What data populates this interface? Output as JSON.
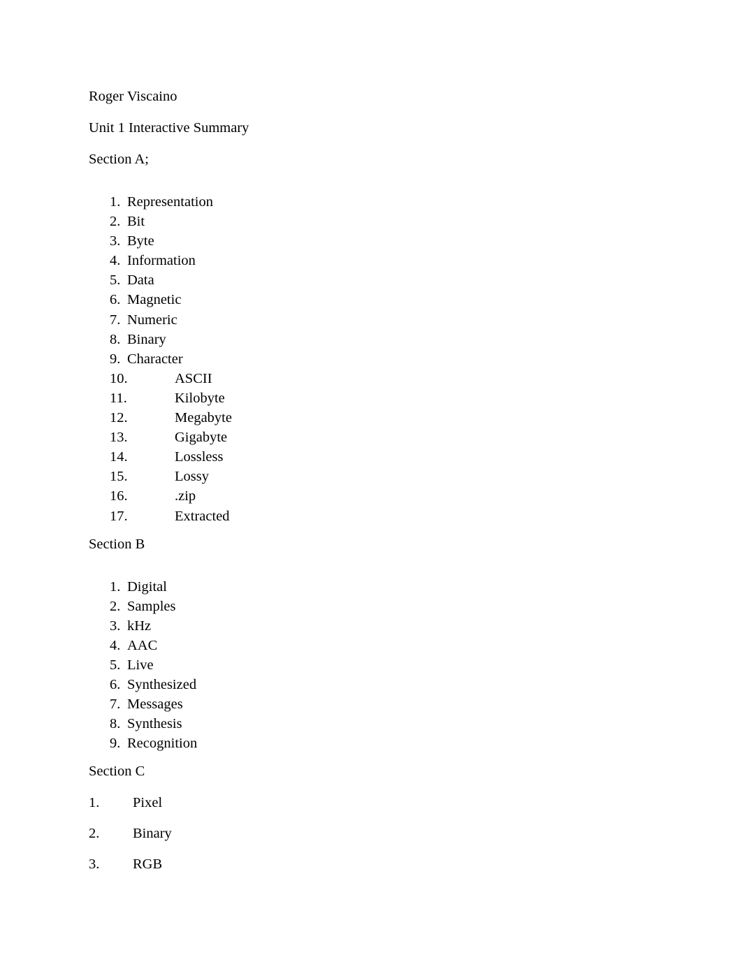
{
  "document": {
    "author_line": "Roger Viscaino",
    "title_line": "Unit 1 Interactive Summary"
  },
  "sections": {
    "a": {
      "heading": "Section A;",
      "items": [
        {
          "number": "1.",
          "text": "Representation"
        },
        {
          "number": "2.",
          "text": "Bit"
        },
        {
          "number": "3.",
          "text": "Byte"
        },
        {
          "number": "4.",
          "text": "Information"
        },
        {
          "number": "5.",
          "text": "Data"
        },
        {
          "number": "6.",
          "text": "Magnetic"
        },
        {
          "number": "7.",
          "text": "Numeric"
        },
        {
          "number": "8.",
          "text": "Binary"
        },
        {
          "number": "9.",
          "text": "Character"
        },
        {
          "number": "10.",
          "text": "ASCII"
        },
        {
          "number": "11.",
          "text": "Kilobyte"
        },
        {
          "number": "12.",
          "text": "Megabyte"
        },
        {
          "number": "13.",
          "text": "Gigabyte"
        },
        {
          "number": "14.",
          "text": "Lossless"
        },
        {
          "number": "15.",
          "text": "Lossy"
        },
        {
          "number": "16.",
          "text": ".zip"
        },
        {
          "number": "17.",
          "text": "Extracted"
        }
      ]
    },
    "b": {
      "heading": "Section B",
      "items": [
        {
          "number": "1.",
          "text": "Digital"
        },
        {
          "number": "2.",
          "text": "Samples"
        },
        {
          "number": "3.",
          "text": "kHz"
        },
        {
          "number": "4.",
          "text": "AAC"
        },
        {
          "number": "5.",
          "text": "Live"
        },
        {
          "number": "6.",
          "text": "Synthesized"
        },
        {
          "number": "7.",
          "text": "Messages"
        },
        {
          "number": "8.",
          "text": "Synthesis"
        },
        {
          "number": "9.",
          "text": "Recognition"
        }
      ]
    },
    "c": {
      "heading": "Section C",
      "items": [
        {
          "number": "1.",
          "text": "Pixel"
        },
        {
          "number": "2.",
          "text": "Binary"
        },
        {
          "number": "3.",
          "text": "RGB"
        }
      ]
    }
  },
  "colors": {
    "page_background": "#ffffff",
    "text": "#000000"
  }
}
